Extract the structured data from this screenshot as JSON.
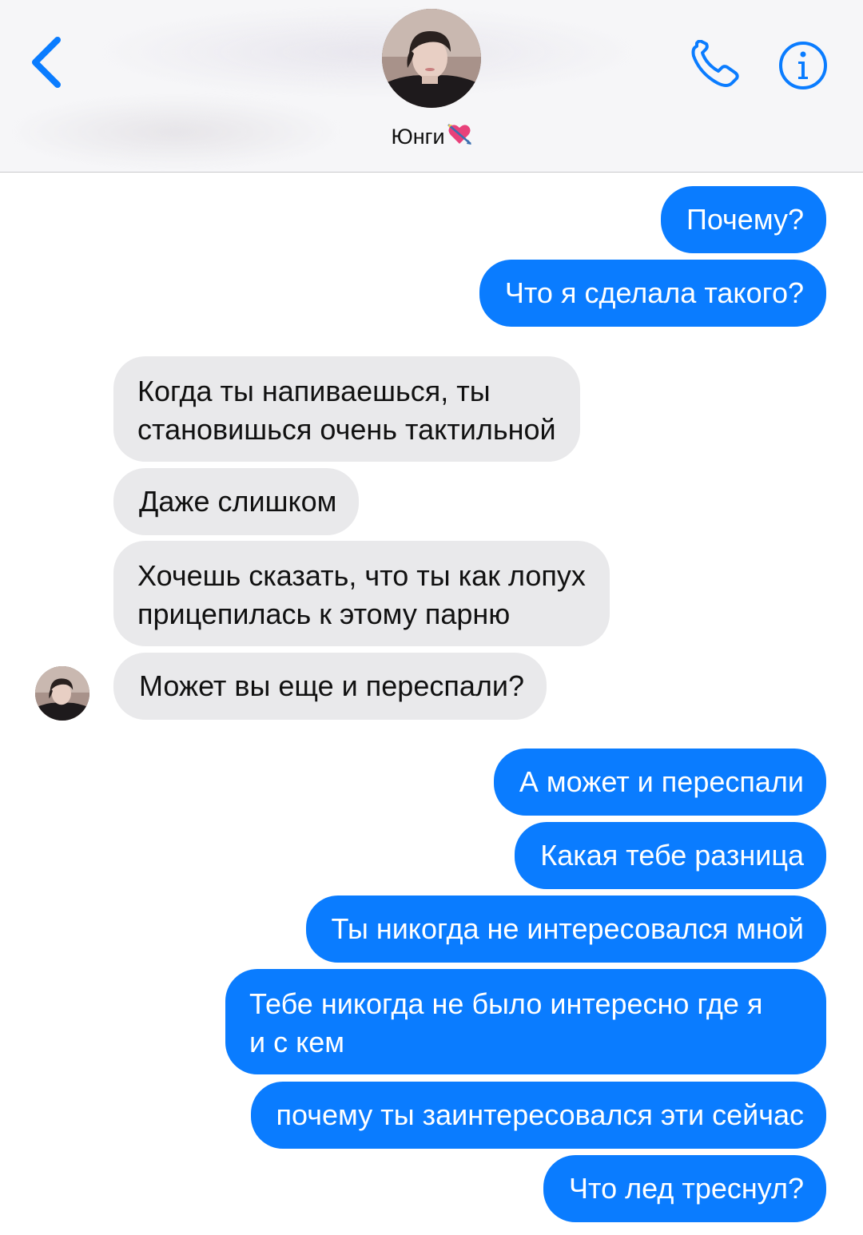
{
  "header": {
    "contact_name": "Юнги",
    "back_icon": "chevron-left-icon",
    "phone_icon": "phone-icon",
    "info_icon": "info-icon",
    "name_emoji": "heart-with-arrow-icon",
    "accent_color": "#0a7cff"
  },
  "messages": [
    {
      "direction": "outgoing",
      "text": "Почему?"
    },
    {
      "direction": "outgoing",
      "text": "Что я сделала такого?"
    },
    {
      "direction": "incoming",
      "lines": [
        "Когда ты напиваешься, ты",
        "становишься очень тактильной"
      ]
    },
    {
      "direction": "incoming",
      "text": "Даже слишком"
    },
    {
      "direction": "incoming",
      "lines": [
        "Хочешь сказать, что ты как лопух",
        "прицепилась к этому парню"
      ]
    },
    {
      "direction": "incoming",
      "text": "Может вы еще и переспали?"
    },
    {
      "direction": "outgoing",
      "text": "А может и переспали"
    },
    {
      "direction": "outgoing",
      "text": "Какая тебе разница"
    },
    {
      "direction": "outgoing",
      "text": "Ты никогда не интересовался мной"
    },
    {
      "direction": "outgoing",
      "lines": [
        "Тебе никогда не было интересно где я",
        "и с кем"
      ]
    },
    {
      "direction": "outgoing",
      "text": "почему ты заинтересовался эти сейчас"
    },
    {
      "direction": "outgoing",
      "text": "Что лед треснул?"
    }
  ],
  "colors": {
    "outgoing_bubble": "#0a7cff",
    "incoming_bubble": "#e9e9eb",
    "header_background": "#f6f6f8"
  }
}
